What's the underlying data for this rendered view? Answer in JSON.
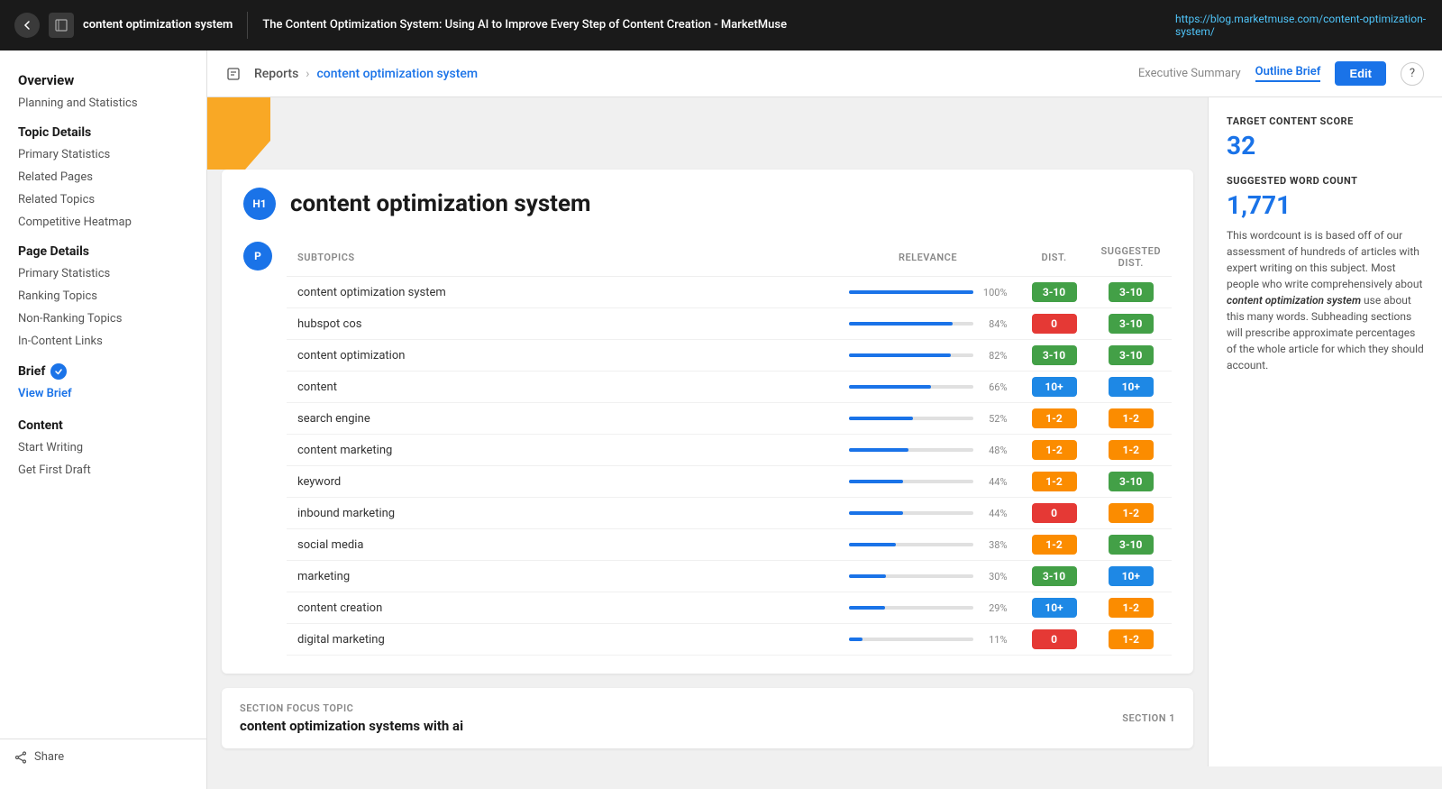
{
  "topbar": {
    "back_label": "←",
    "app_title": "content optimization\nsystem",
    "doc_title": "The Content Optimization System: Using AI to Improve Every Step of Content Creation - MarketMuse",
    "url": "https://blog.marketmuse.com/content-optimization-system/"
  },
  "header": {
    "reports_label": "Reports",
    "breadcrumb_sep": "›",
    "current_page": "content optimization system",
    "exec_summary": "Executive Summary",
    "outline_brief": "Outline Brief",
    "edit_label": "Edit",
    "help_label": "?"
  },
  "sidebar": {
    "overview_label": "Overview",
    "planning_label": "Planning and Statistics",
    "topic_details_label": "Topic Details",
    "primary_stats_1": "Primary Statistics",
    "related_pages": "Related Pages",
    "related_topics": "Related Topics",
    "competitive_heatmap": "Competitive Heatmap",
    "page_details_label": "Page Details",
    "primary_stats_2": "Primary Statistics",
    "ranking_topics": "Ranking Topics",
    "non_ranking_topics": "Non-Ranking Topics",
    "in_content_links": "In-Content Links",
    "brief_label": "Brief",
    "view_brief": "View Brief",
    "content_label": "Content",
    "start_writing": "Start Writing",
    "get_first_draft": "Get First Draft",
    "share_label": "Share"
  },
  "article": {
    "h1_badge": "H1",
    "p_badge": "P",
    "title": "content optimization system",
    "subtopics_col": "SUBTOPICS",
    "relevance_col": "RELEVANCE",
    "dist_col": "DIST.",
    "suggested_dist_col": "SUGGESTED DIST.",
    "rows": [
      {
        "topic": "content optimization system",
        "pct": 100,
        "dist": "3-10",
        "dist_color": "green",
        "sugg": "3-10",
        "sugg_color": "green"
      },
      {
        "topic": "hubspot cos",
        "pct": 84,
        "dist": "0",
        "dist_color": "red",
        "sugg": "3-10",
        "sugg_color": "green"
      },
      {
        "topic": "content optimization",
        "pct": 82,
        "dist": "3-10",
        "dist_color": "green",
        "sugg": "3-10",
        "sugg_color": "green"
      },
      {
        "topic": "content",
        "pct": 66,
        "dist": "10+",
        "dist_color": "blue",
        "sugg": "10+",
        "sugg_color": "blue"
      },
      {
        "topic": "search engine",
        "pct": 52,
        "dist": "1-2",
        "dist_color": "orange",
        "sugg": "1-2",
        "sugg_color": "orange"
      },
      {
        "topic": "content marketing",
        "pct": 48,
        "dist": "1-2",
        "dist_color": "orange",
        "sugg": "1-2",
        "sugg_color": "orange"
      },
      {
        "topic": "keyword",
        "pct": 44,
        "dist": "1-2",
        "dist_color": "orange",
        "sugg": "3-10",
        "sugg_color": "green"
      },
      {
        "topic": "inbound marketing",
        "pct": 44,
        "dist": "0",
        "dist_color": "red",
        "sugg": "1-2",
        "sugg_color": "orange"
      },
      {
        "topic": "social media",
        "pct": 38,
        "dist": "1-2",
        "dist_color": "orange",
        "sugg": "3-10",
        "sugg_color": "green"
      },
      {
        "topic": "marketing",
        "pct": 30,
        "dist": "3-10",
        "dist_color": "green",
        "sugg": "10+",
        "sugg_color": "blue"
      },
      {
        "topic": "content creation",
        "pct": 29,
        "dist": "10+",
        "dist_color": "blue",
        "sugg": "1-2",
        "sugg_color": "orange"
      },
      {
        "topic": "digital marketing",
        "pct": 11,
        "dist": "0",
        "dist_color": "red",
        "sugg": "1-2",
        "sugg_color": "orange"
      }
    ]
  },
  "section": {
    "focus_label": "SECTION FOCUS TOPIC",
    "focus_value": "content optimization systems with ai",
    "section_num": "SECTION 1"
  },
  "right_panel": {
    "target_score_label": "TARGET CONTENT SCORE",
    "target_score_value": "32",
    "word_count_label": "SUGGESTED WORD COUNT",
    "word_count_value": "1,771",
    "description": "This wordcount is is based off of our assessment of hundreds of articles with expert writing on this subject. Most people who write comprehensively about content optimization system use about this many words. Subheading sections will prescribe approximate percentages of the whole article for which they should account.",
    "italic_phrase": "content optimization system"
  }
}
